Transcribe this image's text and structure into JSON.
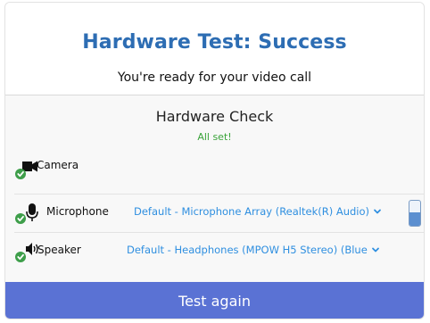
{
  "header": {
    "title": "Hardware Test: Success",
    "subtitle": "You're ready for your video call"
  },
  "hardware_check": {
    "title": "Hardware Check",
    "status": "All set!",
    "status_color": "#3aa33a",
    "devices": {
      "camera": {
        "label": "Camera",
        "icon": "camera-icon",
        "check": "check-icon"
      },
      "microphone": {
        "label": "Microphone",
        "icon": "microphone-icon",
        "check": "check-icon",
        "selected": "Default - Microphone Array (Realtek(R) Audio)",
        "level": 0.55
      },
      "speaker": {
        "label": "Speaker",
        "icon": "speaker-icon",
        "check": "check-icon",
        "selected": "Default - Headphones (MPOW H5 Stereo) (Blue"
      }
    }
  },
  "footer": {
    "button_label": "Test again"
  },
  "colors": {
    "title": "#2d6db3",
    "link": "#2f8fe0",
    "button": "#5a72d4",
    "check": "#3e9e4a"
  }
}
